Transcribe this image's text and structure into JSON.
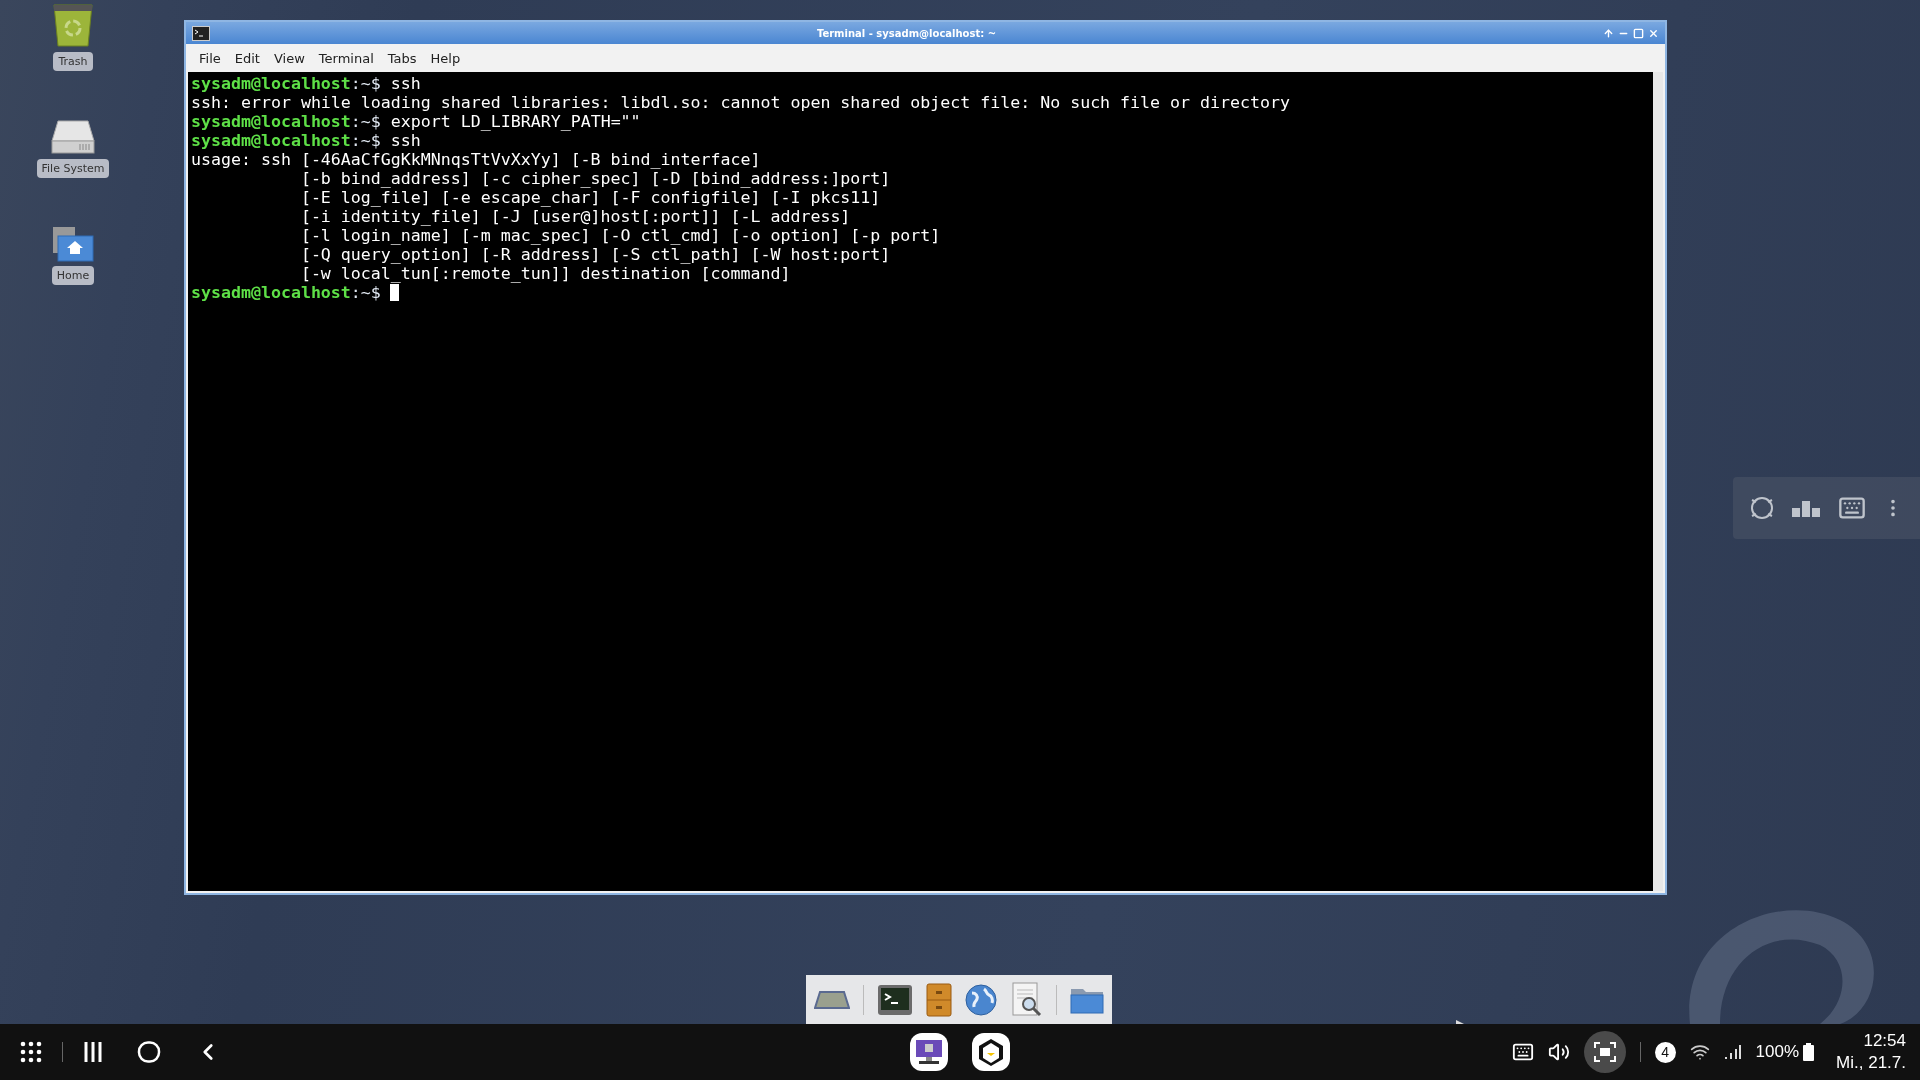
{
  "desktop_icons": [
    {
      "kind": "trash",
      "label": "Trash"
    },
    {
      "kind": "drive",
      "label": "File System"
    },
    {
      "kind": "home",
      "label": "Home"
    }
  ],
  "window": {
    "title": "Terminal - sysadm@localhost: ~",
    "menu": [
      "File",
      "Edit",
      "View",
      "Terminal",
      "Tabs",
      "Help"
    ]
  },
  "terminal": {
    "lines": [
      {
        "kind": "prompt",
        "user_host": "sysadm@localhost",
        "path": ":~$",
        "command": "ssh",
        "cursor": false
      },
      {
        "kind": "output",
        "text": "ssh: error while loading shared libraries: libdl.so: cannot open shared object file: No such file or directory"
      },
      {
        "kind": "prompt",
        "user_host": "sysadm@localhost",
        "path": ":~$",
        "command": "export LD_LIBRARY_PATH=\"\"",
        "cursor": false
      },
      {
        "kind": "prompt",
        "user_host": "sysadm@localhost",
        "path": ":~$",
        "command": "ssh",
        "cursor": false
      },
      {
        "kind": "output",
        "text": "usage: ssh [-46AaCfGgKkMNnqsTtVvXxYy] [-B bind_interface]"
      },
      {
        "kind": "output",
        "text": "           [-b bind_address] [-c cipher_spec] [-D [bind_address:]port]"
      },
      {
        "kind": "output",
        "text": "           [-E log_file] [-e escape_char] [-F configfile] [-I pkcs11]"
      },
      {
        "kind": "output",
        "text": "           [-i identity_file] [-J [user@]host[:port]] [-L address]"
      },
      {
        "kind": "output",
        "text": "           [-l login_name] [-m mac_spec] [-O ctl_cmd] [-o option] [-p port]"
      },
      {
        "kind": "output",
        "text": "           [-Q query_option] [-R address] [-S ctl_path] [-W host:port]"
      },
      {
        "kind": "output",
        "text": "           [-w local_tun[:remote_tun]] destination [command]"
      },
      {
        "kind": "prompt",
        "user_host": "sysadm@localhost",
        "path": ":~$",
        "cursor": true
      }
    ]
  },
  "status_bar": {
    "notification_count": "4",
    "battery": "100%",
    "time": "12:54",
    "date": "Mi., 21.7."
  }
}
